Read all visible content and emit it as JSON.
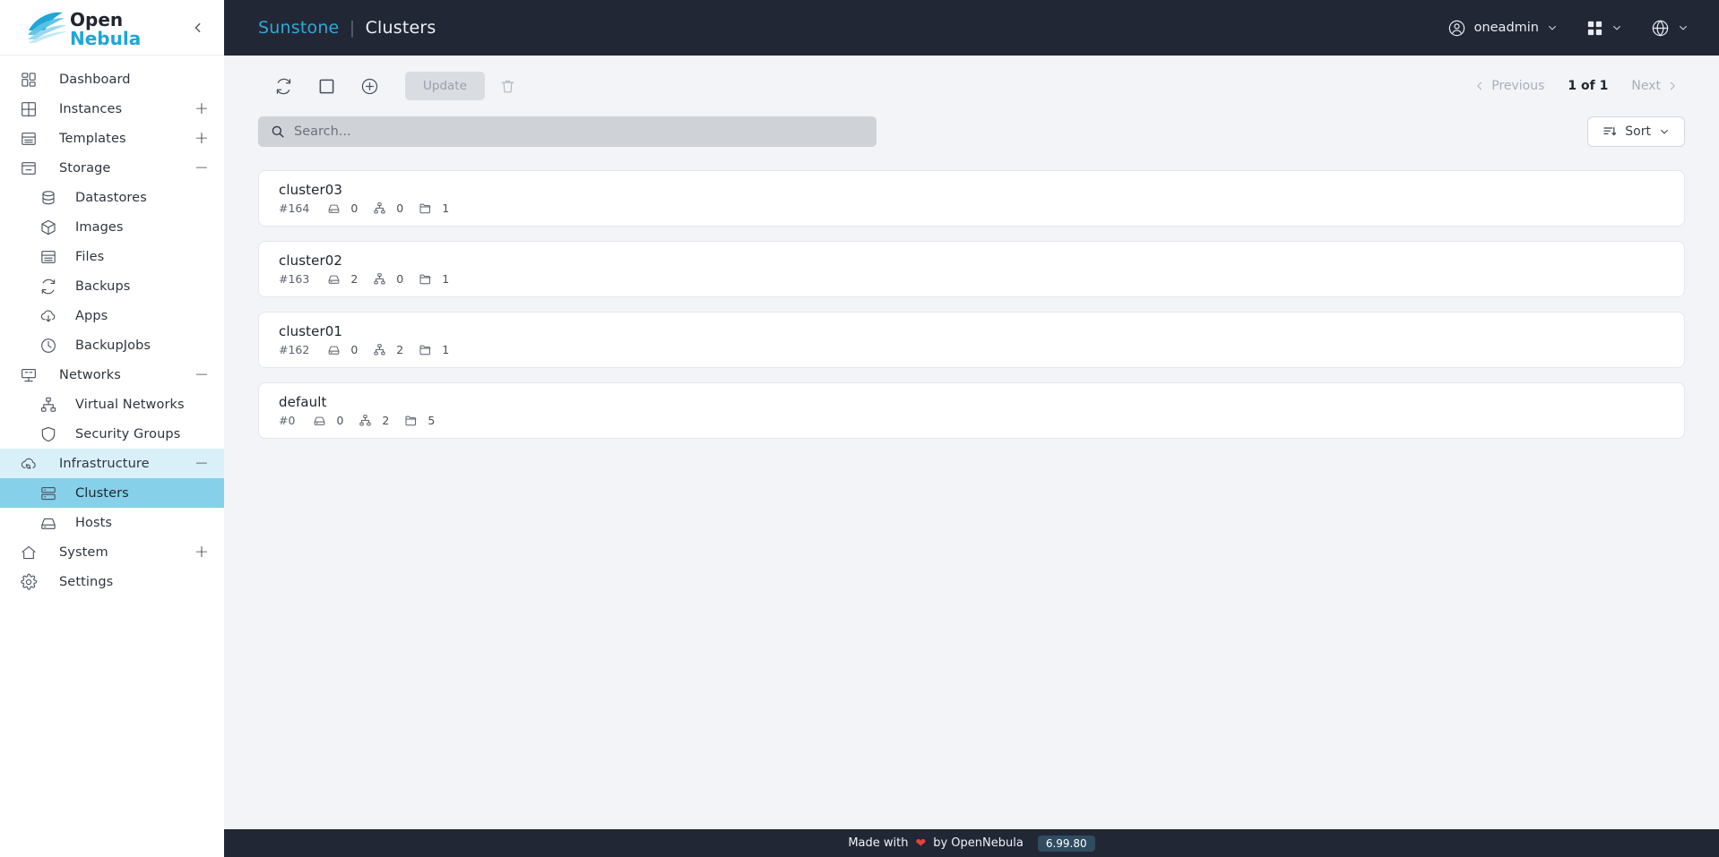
{
  "app": {
    "logo_text_open": "Open",
    "logo_text_nebula": "Nebula",
    "collapse_icon": "chevron-left-icon"
  },
  "sidebar": {
    "items": [
      {
        "label": "Dashboard",
        "icon": "dashboard-icon",
        "level": "top",
        "tail": "",
        "state": ""
      },
      {
        "label": "Instances",
        "icon": "instances-icon",
        "level": "top",
        "tail": "+",
        "state": ""
      },
      {
        "label": "Templates",
        "icon": "templates-icon",
        "level": "top",
        "tail": "+",
        "state": ""
      },
      {
        "label": "Storage",
        "icon": "storage-icon",
        "level": "top",
        "tail": "−",
        "state": ""
      },
      {
        "label": "Datastores",
        "icon": "datastore-icon",
        "level": "sub",
        "tail": "",
        "state": ""
      },
      {
        "label": "Images",
        "icon": "image-box-icon",
        "level": "sub",
        "tail": "",
        "state": ""
      },
      {
        "label": "Files",
        "icon": "files-icon",
        "level": "sub",
        "tail": "",
        "state": ""
      },
      {
        "label": "Backups",
        "icon": "backup-refresh-icon",
        "level": "sub",
        "tail": "",
        "state": ""
      },
      {
        "label": "Apps",
        "icon": "cloud-download-icon",
        "level": "sub",
        "tail": "",
        "state": ""
      },
      {
        "label": "BackupJobs",
        "icon": "clock-icon",
        "level": "sub",
        "tail": "",
        "state": ""
      },
      {
        "label": "Networks",
        "icon": "network-monitor-icon",
        "level": "top",
        "tail": "−",
        "state": ""
      },
      {
        "label": "Virtual Networks",
        "icon": "sitemap-icon",
        "level": "sub",
        "tail": "",
        "state": ""
      },
      {
        "label": "Security Groups",
        "icon": "shield-icon",
        "level": "sub",
        "tail": "",
        "state": ""
      },
      {
        "label": "Infrastructure",
        "icon": "cloud-sync-icon",
        "level": "top",
        "tail": "−",
        "state": "group-open"
      },
      {
        "label": "Clusters",
        "icon": "cluster-server-icon",
        "level": "sub",
        "tail": "",
        "state": "active"
      },
      {
        "label": "Hosts",
        "icon": "host-icon",
        "level": "sub",
        "tail": "",
        "state": ""
      },
      {
        "label": "System",
        "icon": "home-icon",
        "level": "top",
        "tail": "+",
        "state": ""
      },
      {
        "label": "Settings",
        "icon": "gear-icon",
        "level": "top",
        "tail": "",
        "state": ""
      }
    ]
  },
  "header": {
    "app_name": "Sunstone",
    "separator": "|",
    "section": "Clusters",
    "user": {
      "name": "oneadmin",
      "icon": "user-circle-icon",
      "chevron": "chevron-down-icon"
    },
    "apps_menu": {
      "icon": "grid-apps-icon",
      "chevron": "chevron-down-icon"
    },
    "language_menu": {
      "icon": "globe-icon",
      "chevron": "chevron-down-icon"
    }
  },
  "toolbar": {
    "refresh": {
      "label": "",
      "icon": "refresh-icon"
    },
    "select_all": {
      "label": "",
      "icon": "square-select-icon"
    },
    "create": {
      "label": "",
      "icon": "plus-circle-icon"
    },
    "update_label": "Update",
    "delete": {
      "label": "",
      "icon": "trash-icon"
    }
  },
  "pagination": {
    "previous_label": "Previous",
    "next_label": "Next",
    "page_info": "1 of 1"
  },
  "search": {
    "placeholder": "Search...",
    "value": "",
    "icon": "search-icon"
  },
  "sort": {
    "label": "Sort",
    "icon": "sort-icon",
    "chevron": "chevron-down-icon"
  },
  "clusters": [
    {
      "name": "cluster03",
      "id": "#164",
      "hosts": "0",
      "vnets": "0",
      "datastores": "1"
    },
    {
      "name": "cluster02",
      "id": "#163",
      "hosts": "2",
      "vnets": "0",
      "datastores": "1"
    },
    {
      "name": "cluster01",
      "id": "#162",
      "hosts": "0",
      "vnets": "2",
      "datastores": "1"
    },
    {
      "name": "default",
      "id": "#0",
      "hosts": "0",
      "vnets": "2",
      "datastores": "5"
    }
  ],
  "footer": {
    "made_with": "Made with",
    "heart": "❤",
    "by": "by OpenNebula",
    "version": "6.99.80"
  },
  "colors": {
    "accent": "#2fa8d8",
    "sidebar_active": "#86d0e9",
    "sidebar_group_open": "#daf0f8",
    "topbar_bg": "#222736",
    "content_bg": "#f2f4f7",
    "version_badge": "#2f4c60",
    "heart": "#e8413c"
  }
}
